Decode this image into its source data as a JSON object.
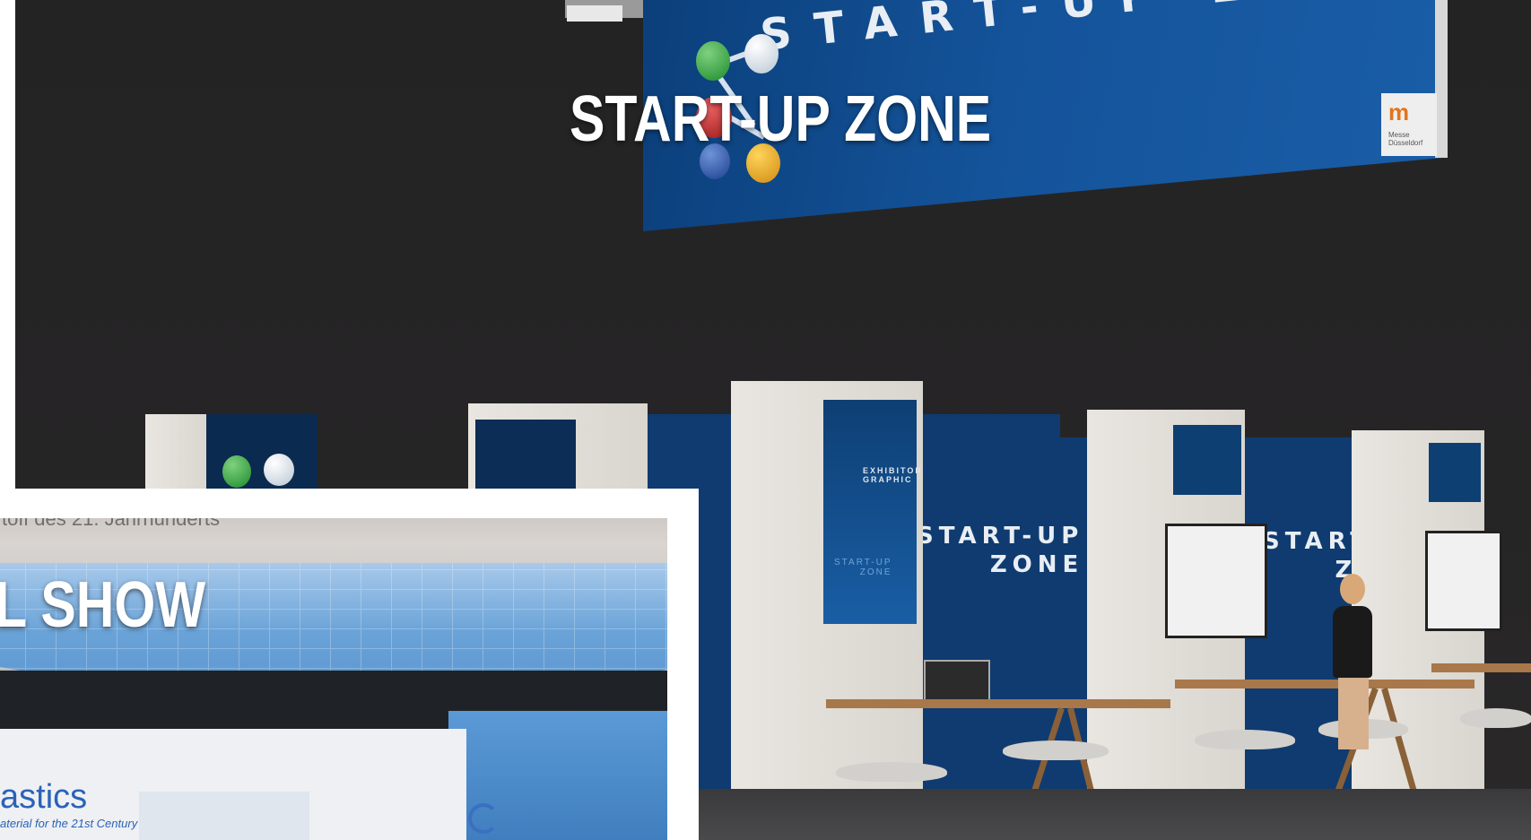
{
  "captions": {
    "main": "START-UP ZONE",
    "inset": "L SHOW"
  },
  "scene": {
    "banner_text": "START-UP ZONE",
    "banner_logo_mark": "m",
    "banner_logo_small": "Messe\nDüsseldorf",
    "screen_label": "EXHIBITOR\nGRAPHIC",
    "screen_sub": "START-UP\nZONE",
    "wall_text_1": "START-UP\nZONE",
    "wall_text_2": "START-U\nZON"
  },
  "inset": {
    "top_text": "toff des 21. Jahrhunderts",
    "brand": "astics",
    "brand_sub": "aterial for the 21st Century"
  }
}
